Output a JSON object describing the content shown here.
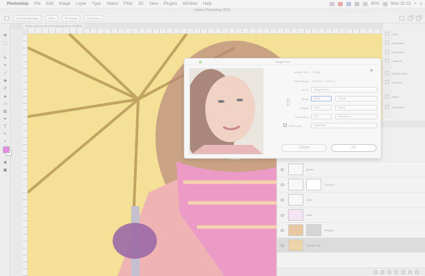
{
  "menubar": {
    "app_name": "Photoshop",
    "items": [
      "File",
      "Edit",
      "Image",
      "Layer",
      "Type",
      "Select",
      "Filter",
      "3D",
      "View",
      "Plugins",
      "Window",
      "Help"
    ],
    "battery": "90%",
    "clock": "Mon 20:13"
  },
  "window": {
    "title": "Adobe Photoshop 2021"
  },
  "options": {
    "scroll_all": "Scroll All Windows",
    "zoom_100": "100%",
    "fit_screen": "Fit Screen",
    "fill_screen": "Fill Screen"
  },
  "document_tab": {
    "label": "smile-split.psd @ 100% (Background, RGB/8)"
  },
  "tools": {
    "foreground_color": "#e58be6",
    "background_color": "#fafafa"
  },
  "panels": {
    "items": [
      "Color",
      "Swatches",
      "Gradients",
      "Patterns",
      "Adjustments",
      "Libraries",
      "Paths",
      "Properties"
    ]
  },
  "layers": {
    "items": [
      {
        "name": "guans"
      },
      {
        "name": "Curves 1"
      },
      {
        "name": "ribbs"
      },
      {
        "name": "whits"
      },
      {
        "name": "pinkgeo"
      },
      {
        "name": "Background"
      }
    ]
  },
  "dialog": {
    "title": "Image Size",
    "image_size_label": "Image Size:",
    "image_size_value": "23.8M",
    "dimensions_label": "Dimensions:",
    "dimensions_value": "4200 px × 2930 px",
    "fit_to_label": "Fit To:",
    "fit_to_value": "Original Size",
    "width_label": "Width:",
    "width_value": "4200",
    "width_unit": "Pixels",
    "height_label": "Height:",
    "height_value": "2930",
    "height_unit": "Pixels",
    "resolution_label": "Resolution:",
    "resolution_value": "300",
    "resolution_unit": "Pixels/Inch",
    "resample_label": "Resample:",
    "resample_value": "Automatic",
    "cancel_label": "Cancel",
    "ok_label": "OK"
  },
  "colors": {
    "canvas_yellow": "#f5e196",
    "umbrella_frame": "#8a6a2e",
    "hair": "#a27a6a",
    "scarf_pink": "#ec9ac6",
    "coat": "#f0b3b4",
    "glove": "#9b6aa6"
  }
}
